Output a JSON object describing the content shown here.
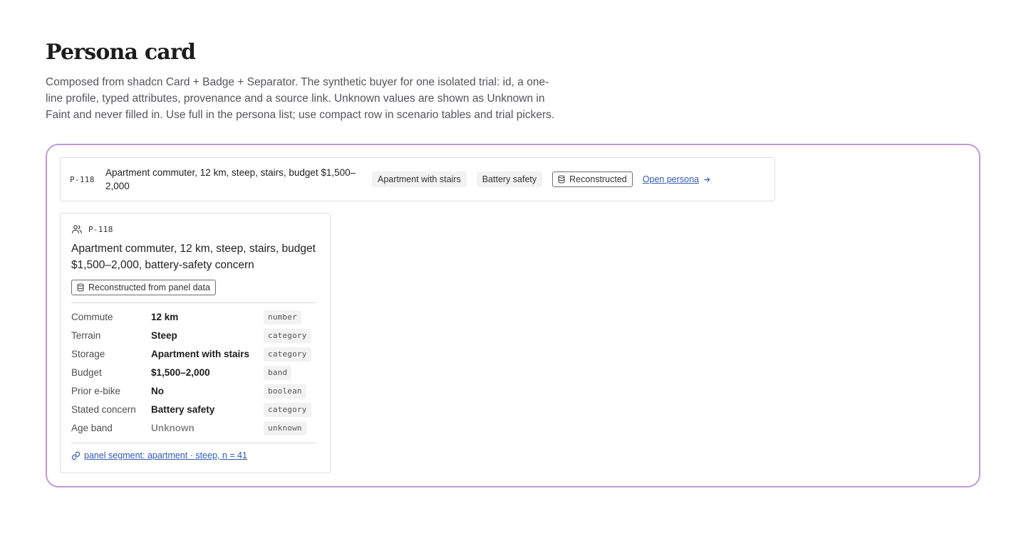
{
  "page": {
    "title": "Persona card",
    "description": "Composed from shadcn Card + Badge + Separator. The synthetic buyer for one isolated trial: id, a one-line profile, typed attributes, provenance and a source link. Unknown values are shown as Unknown in Faint and never filled in. Use full in the persona list; use compact row in scenario tables and trial pickers."
  },
  "compact_row": {
    "id": "P-118",
    "profile": "Apartment commuter, 12 km, steep, stairs, budget $1,500–2,000",
    "chips": [
      "Apartment with stairs",
      "Battery safety"
    ],
    "provenance": "Reconstructed",
    "link": "Open persona"
  },
  "full_card": {
    "id": "P-118",
    "profile": "Apartment commuter, 12 km, steep, stairs, budget $1,500–2,000, battery-safety concern",
    "provenance": "Reconstructed from panel data",
    "attributes": [
      {
        "label": "Commute",
        "value": "12 km",
        "type": "number"
      },
      {
        "label": "Terrain",
        "value": "Steep",
        "type": "category"
      },
      {
        "label": "Storage",
        "value": "Apartment with stairs",
        "type": "category"
      },
      {
        "label": "Budget",
        "value": "$1,500–2,000",
        "type": "band"
      },
      {
        "label": "Prior e-bike",
        "value": "No",
        "type": "boolean"
      },
      {
        "label": "Stated concern",
        "value": "Battery safety",
        "type": "category"
      },
      {
        "label": "Age band",
        "value": "Unknown",
        "type": "unknown"
      }
    ],
    "source": "panel segment: apartment · steep, n = 41"
  },
  "colors": {
    "frame_border": "#c197dc",
    "link": "#2f5bb1",
    "unknown_text": "#8a8a8a"
  },
  "icons": [
    "users-icon",
    "database-icon",
    "arrow-right-icon",
    "link-icon"
  ]
}
